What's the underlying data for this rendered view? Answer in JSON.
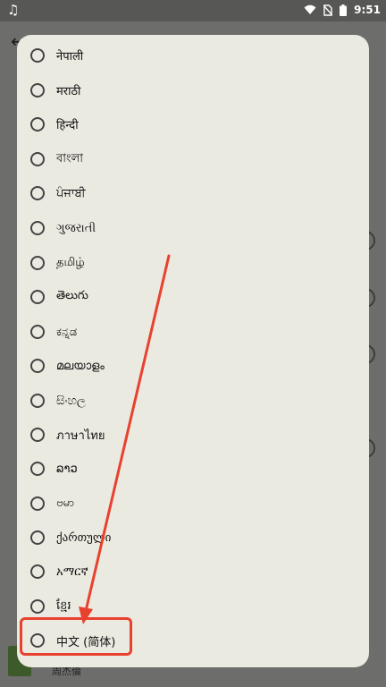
{
  "status_bar": {
    "time": "9:51",
    "icons": [
      "music-note-icon",
      "wifi-icon",
      "no-sim-icon",
      "battery-icon"
    ]
  },
  "background": {
    "thumbnail_caption": "周杰倫"
  },
  "dialog": {
    "selected": null,
    "options": [
      "नेपाली",
      "मराठी",
      "हिन्दी",
      "বাংলা",
      "ਪੰਜਾਬੀ",
      "ગુજરાતી",
      "தமிழ்",
      "తెలుగు",
      "ಕನ್ನಡ",
      "മലയാളം",
      "සිංහල",
      "ภาษาไทย",
      "ລາວ",
      "ဗမာ",
      "ქართული",
      "አማርኛ",
      "ខ្មែរ",
      "中文 (简体)"
    ]
  },
  "annotation": {
    "highlight_color": "#e8422f"
  }
}
